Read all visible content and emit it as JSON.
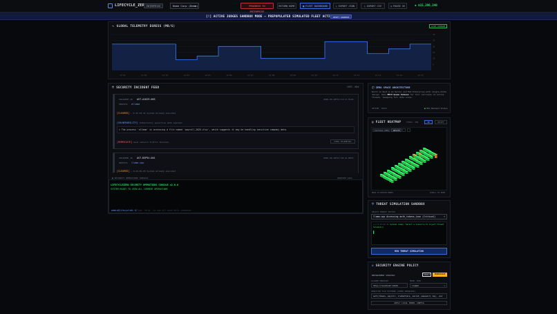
{
  "app": {
    "logo_text": "LIFECYCLE_ZERO",
    "env_badge": "ENTERPRISE",
    "scenario_select": "Home Corp (Demo)",
    "btn_progress": "PROGRESS TO ENTERPRISE",
    "btn_return": "RETURN HOME",
    "btn_fleet": "FLEET DASHBOARD",
    "btn_export_json": "EXPORT JSON",
    "btn_export_csv": "EXPORT CSV",
    "btn_timer": "PAUSE 5S",
    "balance": "$15,296,240"
  },
  "banner": {
    "text": "[!] ACTIVE JUDGES SANDBOX MODE — PREPOPULATED SIMULATED FLEET ACTIVE!",
    "button": "RESET SANDBOX"
  },
  "telemetry": {
    "title": "GLOBAL TELEMETRY EGRESS (MB/S)",
    "live_label": "LIVE STREAM",
    "y_ticks": [
      "30",
      "25",
      "20",
      "15",
      "10",
      "5"
    ],
    "x_ticks": [
      "12:01",
      "12:02",
      "12:03",
      "12:04",
      "12:05",
      "12:06",
      "12:07",
      "12:08",
      "12:09",
      "12:10",
      "12:11",
      "12:12",
      "12:13",
      "12:14",
      "12:15"
    ]
  },
  "chart_data": {
    "type": "area",
    "title": "GLOBAL TELEMETRY EGRESS (MB/S)",
    "ylim": [
      0,
      30
    ],
    "x": [
      "12:01",
      "12:02",
      "12:03",
      "12:04",
      "12:05",
      "12:06",
      "12:07",
      "12:08",
      "12:09",
      "12:10",
      "12:11",
      "12:12",
      "12:13",
      "12:14",
      "12:15"
    ],
    "values": [
      22,
      22,
      22,
      9,
      12,
      20,
      20,
      10,
      10,
      10,
      24,
      24,
      14,
      18,
      22
    ]
  },
  "incidents": {
    "title": "SECURITY INCIDENT FEED",
    "header_right": "SORT: NEW",
    "items": [
      {
        "id_label": "INCIDENT_ID",
        "id": "AST-A1629-003",
        "process_label": "PROCESS",
        "process": "ollama",
        "timestamp": "2026-06-18T13:21:17.512Z",
        "severity": "[CLEARED]",
        "severity_note": "— 0.43.02.31 System already executed",
        "vuln_label": "[VULNERABILITY]",
        "vuln_note": "Potentially sensitive data exposed",
        "message": "> The process 'ollama' is accessing a file named 'payroll_2025.xlsx', which suggests it may be handling sensitive company data.",
        "remediation_label": "[REMEDIATE]",
        "remediation": "Send network traffic blocked",
        "action_button": "VIEW TELEMETRY"
      },
      {
        "id_label": "INCIDENT_ID",
        "id": "AST-B3P9X-001",
        "process_label": "PROCESS",
        "process": "llama.cpp",
        "timestamp": "2026-06-18T13:20:41.087Z",
        "severity": "[CLEARED]",
        "severity_note": "— 0.43.02.05 System already executed"
      }
    ]
  },
  "terminal": {
    "title": "SECURITY OPERATIONS CONSOLE",
    "header_right": "ARCHIVE LOGS",
    "line1": "LIFECYCLEZERO SECURITY OPERATIONS CONSOLE v2.0.0",
    "line2": "SYSTEM READY TO VIEW ALL CURRENT OPERATIONS",
    "prompt": "admin@lifecycle0:~$",
    "input_placeholder": "Type 'help' to see all available commands"
  },
  "architecture": {
    "title": "ZERO SPACE ARCHITECTURE",
    "desc_a": "Built on Rust & Go Kernel and MAC Enterprise with single-state design. Uses",
    "desc_highlight": "MECH Queue Indexes",
    "desc_b": "for full retrieval of active threats. Sweeping full data scans.",
    "footer_left": "UPTIME: 7DAYS",
    "footer_right": "MAC Backend Status"
  },
  "heatmap": {
    "title": "FLEET HEATMAP",
    "tab_total": "TOTAL: 256",
    "tab_3d": "3D",
    "btn_reset": "RESET",
    "view_tag": "TACTICAL VIEW",
    "view_btn": "ROTATE",
    "footer_left": "DRAG TO ROTATE MODEL",
    "footer_right": "SCROLL TO ZOOM"
  },
  "threat_sim": {
    "title": "THREAT SIMULATION SANDBOX",
    "target_label": "SELECT THREAT VECTOR",
    "target_value": "llama.cpp Accessing auth_tokens.json (Critical)",
    "log_line1": "[+] 0.43.02.31",
    "log_line1b": "System ready. Select a scenario to inject threat telemetry.",
    "cursor": "▌",
    "run_button": "RUN THREAT SIMULATION"
  },
  "policy": {
    "title": "SECURITY ENGINE POLICY",
    "strategy_label": "ENFORCEMENT STRATEGY",
    "toggle_a": "STRICT",
    "toggle_b": "PERMISSIVE",
    "url_label": "ALLOWED ENDPOINT",
    "url_value": "http://localhost:11434",
    "model_label": "MODEL TIER",
    "model_value": "llama3",
    "rules_label": "SENSITIVE FILE PATTERNS (COMMA SEPARATED)",
    "rules_value": "auth_tokens, payroll, credentials, secret, password, key, .env",
    "apply_button": "APPLY LOCAL MODEL CONFIG"
  }
}
